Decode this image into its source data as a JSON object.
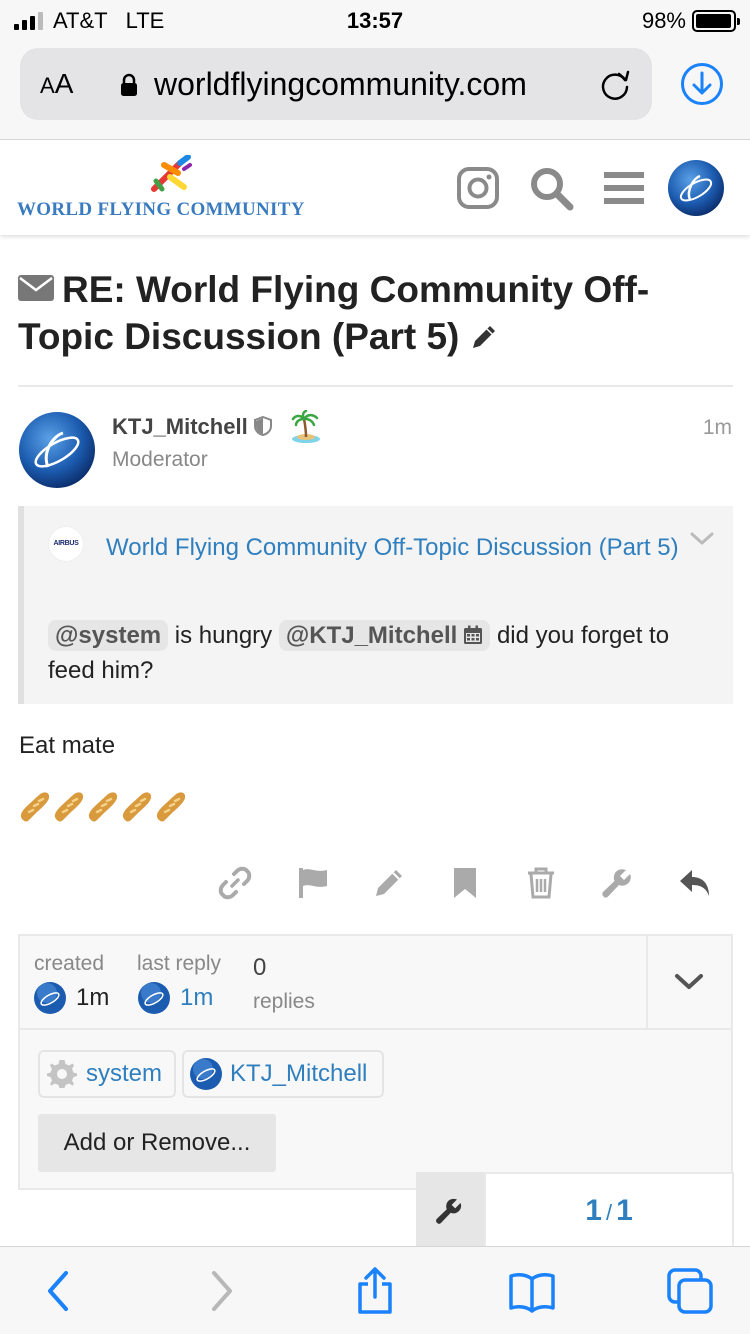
{
  "status_bar": {
    "carrier": "AT&T",
    "network": "LTE",
    "time": "13:57",
    "battery": "98%",
    "battery_level": 0.98
  },
  "browser": {
    "aa_small": "A",
    "aa_large": "A",
    "url": "worldflyingcommunity.com"
  },
  "site": {
    "logo_text": "WORLD FLYING COMMUNITY"
  },
  "topic": {
    "title": "RE: World Flying Community Off-Topic Discussion (Part 5)"
  },
  "post": {
    "username": "KTJ_Mitchell",
    "user_title": "Moderator",
    "time": "1m",
    "quote": {
      "avatar_text": "AIRBUS",
      "title": "World Flying Community Off-Topic Discussion (Part 5)",
      "mention_1": "@system",
      "text_1": " is hungry ",
      "mention_2": "@KTJ_Mitchell",
      "text_2": " did you forget to feed him?"
    },
    "body": "Eat mate"
  },
  "topic_map": {
    "created_label": "created",
    "created_value": "1m",
    "last_reply_label": "last reply",
    "last_reply_value": "1m",
    "replies_count": "0",
    "replies_label": "replies",
    "participants": [
      {
        "name": "system"
      },
      {
        "name": "KTJ_Mitchell"
      }
    ],
    "add_button": "Add or Remove..."
  },
  "timeline": {
    "current": "1",
    "separator": "/",
    "total": "1"
  },
  "colors": {
    "link": "#2f7fbf",
    "ios_blue": "#1a82fb"
  }
}
